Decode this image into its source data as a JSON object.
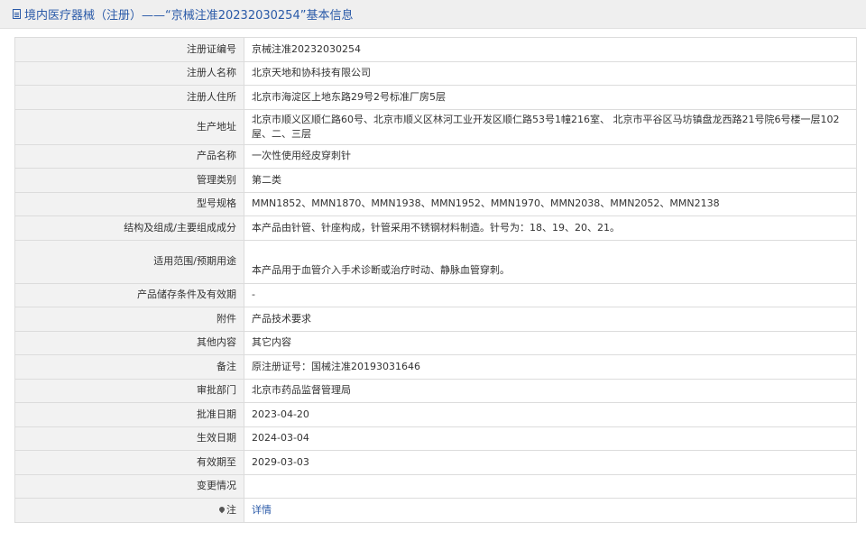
{
  "header": {
    "title": "境内医疗器械（注册）——“京械注准20232030254”基本信息",
    "icon": "document-icon"
  },
  "rows": [
    {
      "label": "注册证编号",
      "value": "京械注准20232030254"
    },
    {
      "label": "注册人名称",
      "value": "北京天地和协科技有限公司"
    },
    {
      "label": "注册人住所",
      "value": "北京市海淀区上地东路29号2号标准厂房5层"
    },
    {
      "label": "生产地址",
      "value": "北京市顺义区顺仁路60号、北京市顺义区林河工业开发区顺仁路53号1幢216室、 北京市平谷区马坊镇盘龙西路21号院6号楼一层102屋、二、三层"
    },
    {
      "label": "产品名称",
      "value": "一次性使用经皮穿刺针"
    },
    {
      "label": "管理类别",
      "value": "第二类"
    },
    {
      "label": "型号规格",
      "value": "MMN1852、MMN1870、MMN1938、MMN1952、MMN1970、MMN2038、MMN2052、MMN2138"
    },
    {
      "label": "结构及组成/主要组成成分",
      "value": "本产品由针管、针座构成，针管采用不锈钢材料制造。针号为：18、19、20、21。"
    },
    {
      "label": "适用范围/预期用途",
      "value": "本产品用于血管介入手术诊断或治疗时动、静脉血管穿刺。"
    },
    {
      "label": "产品储存条件及有效期",
      "value": "-"
    },
    {
      "label": "附件",
      "value": "产品技术要求"
    },
    {
      "label": "其他内容",
      "value": "其它内容"
    },
    {
      "label": "备注",
      "value": "原注册证号：国械注准20193031646"
    },
    {
      "label": "审批部门",
      "value": "北京市药品监督管理局"
    },
    {
      "label": "批准日期",
      "value": "2023-04-20"
    },
    {
      "label": "生效日期",
      "value": "2024-03-04"
    },
    {
      "label": "有效期至",
      "value": "2029-03-03"
    },
    {
      "label": "变更情况",
      "value": ""
    },
    {
      "label": "注",
      "value": "详情",
      "icon": "pin-icon"
    }
  ],
  "colors": {
    "link": "#2a5aa8",
    "label_bg": "#f2f2f2",
    "header_bg": "#efefef",
    "border": "#dcdcdc"
  }
}
